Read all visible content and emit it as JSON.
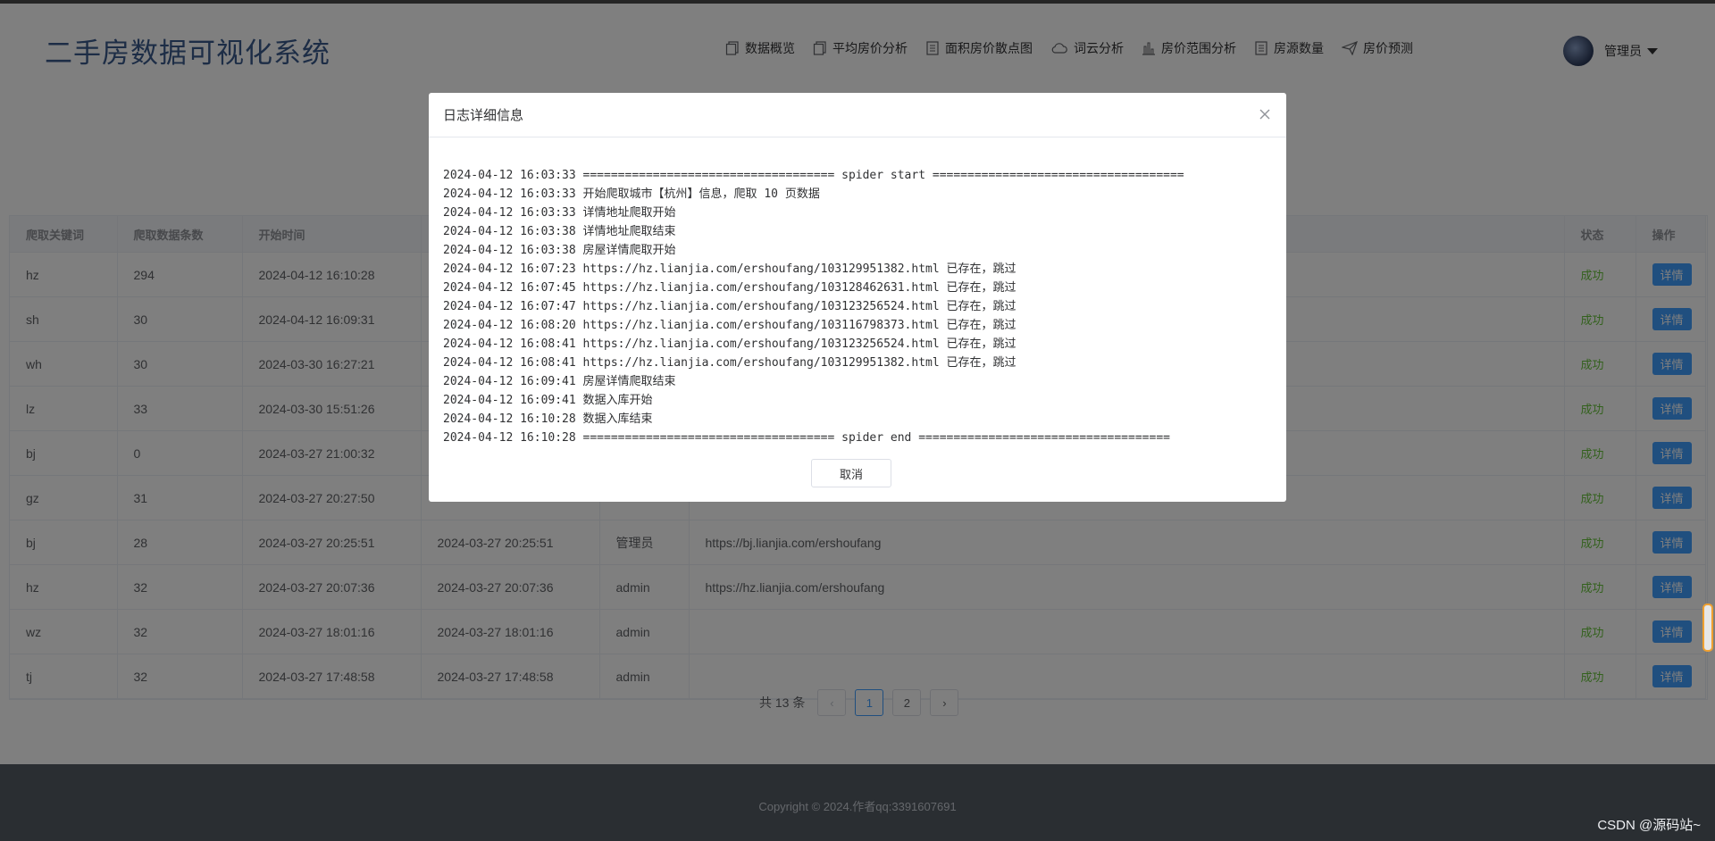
{
  "app": {
    "title": "二手房数据可视化系统"
  },
  "nav": [
    {
      "label": "数据概览",
      "icon": "document-copy-icon"
    },
    {
      "label": "平均房价分析",
      "icon": "document-copy-icon"
    },
    {
      "label": "面积房价散点图",
      "icon": "tickets-icon"
    },
    {
      "label": "词云分析",
      "icon": "cloud-icon"
    },
    {
      "label": "房价范围分析",
      "icon": "bar-chart-icon"
    },
    {
      "label": "房源数量",
      "icon": "tickets-icon"
    },
    {
      "label": "房价预测",
      "icon": "paper-plane-icon"
    }
  ],
  "user": {
    "name": "管理员"
  },
  "table": {
    "headers": [
      "爬取关键词",
      "爬取数据条数",
      "开始时间",
      "",
      "",
      "",
      "状态",
      "操作"
    ],
    "rows": [
      {
        "keyword": "hz",
        "count": "294",
        "start": "2024-04-12 16:10:28",
        "end": "",
        "operator": "",
        "url": "",
        "status": "成功",
        "action": "详情"
      },
      {
        "keyword": "sh",
        "count": "30",
        "start": "2024-04-12 16:09:31",
        "end": "",
        "operator": "",
        "url": "",
        "status": "成功",
        "action": "详情"
      },
      {
        "keyword": "wh",
        "count": "30",
        "start": "2024-03-30 16:27:21",
        "end": "",
        "operator": "",
        "url": "",
        "status": "成功",
        "action": "详情"
      },
      {
        "keyword": "lz",
        "count": "33",
        "start": "2024-03-30 15:51:26",
        "end": "",
        "operator": "",
        "url": "",
        "status": "成功",
        "action": "详情"
      },
      {
        "keyword": "bj",
        "count": "0",
        "start": "2024-03-27 21:00:32",
        "end": "",
        "operator": "",
        "url": "",
        "status": "成功",
        "action": "详情"
      },
      {
        "keyword": "gz",
        "count": "31",
        "start": "2024-03-27 20:27:50",
        "end": "",
        "operator": "",
        "url": "",
        "status": "成功",
        "action": "详情"
      },
      {
        "keyword": "bj",
        "count": "28",
        "start": "2024-03-27 20:25:51",
        "end": "2024-03-27 20:25:51",
        "operator": "管理员",
        "url": "https://bj.lianjia.com/ershoufang",
        "status": "成功",
        "action": "详情"
      },
      {
        "keyword": "hz",
        "count": "32",
        "start": "2024-03-27 20:07:36",
        "end": "2024-03-27 20:07:36",
        "operator": "admin",
        "url": "https://hz.lianjia.com/ershoufang",
        "status": "成功",
        "action": "详情"
      },
      {
        "keyword": "wz",
        "count": "32",
        "start": "2024-03-27 18:01:16",
        "end": "2024-03-27 18:01:16",
        "operator": "admin",
        "url": "",
        "status": "成功",
        "action": "详情"
      },
      {
        "keyword": "tj",
        "count": "32",
        "start": "2024-03-27 17:48:58",
        "end": "2024-03-27 17:48:58",
        "operator": "admin",
        "url": "",
        "status": "成功",
        "action": "详情"
      }
    ]
  },
  "pagination": {
    "total": "共 13 条",
    "prev": "‹",
    "pages": [
      "1",
      "2"
    ],
    "current": "1",
    "next": "›"
  },
  "footer": {
    "copyright": "Copyright © 2024.作者qq:3391607691",
    "watermark": "CSDN @源码站~"
  },
  "dialog": {
    "title": "日志详细信息",
    "cancel": "取消",
    "log_lines": [
      "2024-04-12 16:03:33 ==================================== spider start ====================================",
      "2024-04-12 16:03:33 开始爬取城市【杭州】信息，爬取 10 页数据",
      "2024-04-12 16:03:33 详情地址爬取开始",
      "2024-04-12 16:03:38 详情地址爬取结束",
      "2024-04-12 16:03:38 房屋详情爬取开始",
      "2024-04-12 16:07:23 https://hz.lianjia.com/ershoufang/103129951382.html 已存在，跳过",
      "2024-04-12 16:07:45 https://hz.lianjia.com/ershoufang/103128462631.html 已存在，跳过",
      "2024-04-12 16:07:47 https://hz.lianjia.com/ershoufang/103123256524.html 已存在，跳过",
      "2024-04-12 16:08:20 https://hz.lianjia.com/ershoufang/103116798373.html 已存在，跳过",
      "2024-04-12 16:08:41 https://hz.lianjia.com/ershoufang/103123256524.html 已存在，跳过",
      "2024-04-12 16:08:41 https://hz.lianjia.com/ershoufang/103129951382.html 已存在，跳过",
      "2024-04-12 16:09:41 房屋详情爬取结束",
      "2024-04-12 16:09:41 数据入库开始",
      "2024-04-12 16:10:28 数据入库结束",
      "2024-04-12 16:10:28 ==================================== spider end ===================================="
    ]
  }
}
